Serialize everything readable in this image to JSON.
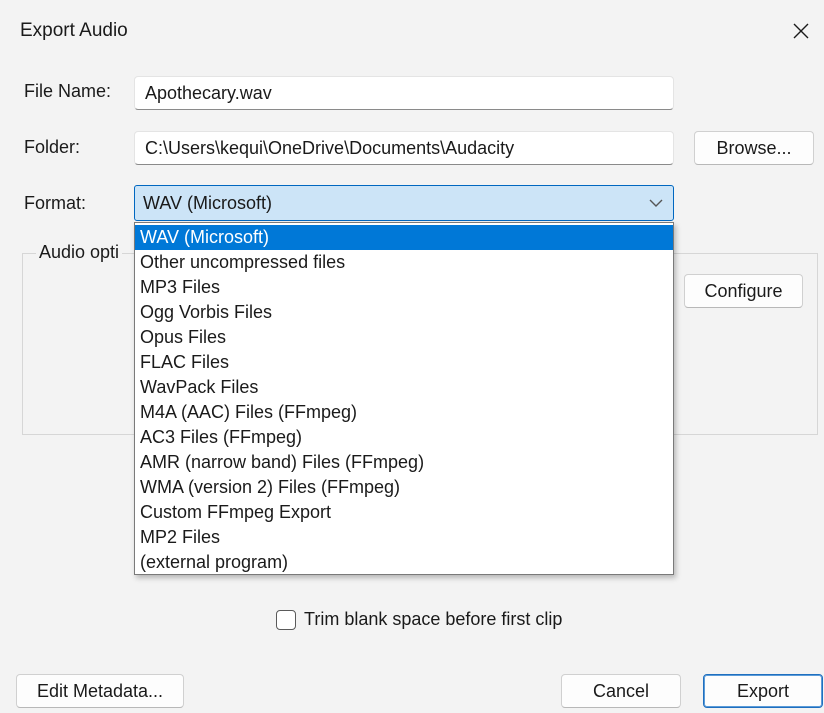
{
  "window": {
    "title": "Export Audio",
    "close_icon": "close-icon"
  },
  "file_name": {
    "label": "File Name:",
    "value": "Apothecary.wav"
  },
  "folder": {
    "label": "Folder:",
    "value": "C:\\Users\\kequi\\OneDrive\\Documents\\Audacity",
    "browse_label": "Browse..."
  },
  "format": {
    "label": "Format:",
    "selected": "WAV (Microsoft)",
    "chevron_icon": "chevron-down-icon",
    "options": [
      "WAV (Microsoft)",
      "Other uncompressed files",
      "MP3 Files",
      "Ogg Vorbis Files",
      "Opus Files",
      "FLAC Files",
      "WavPack Files",
      "M4A (AAC) Files (FFmpeg)",
      "AC3 Files (FFmpeg)",
      "AMR (narrow band) Files (FFmpeg)",
      "WMA (version 2) Files (FFmpeg)",
      "Custom FFmpeg Export",
      "MP2 Files",
      "(external program)"
    ],
    "highlighted_index": 0
  },
  "audio_options": {
    "legend": "Audio opti",
    "configure_label": "Configure"
  },
  "trim": {
    "label": "Trim blank space before first clip",
    "checked": false
  },
  "footer": {
    "edit_metadata_label": "Edit Metadata...",
    "cancel_label": "Cancel",
    "export_label": "Export"
  },
  "colors": {
    "selection": "#0078d7",
    "combo_fill": "#cce4f7",
    "dialog_bg": "#f3f3f3"
  }
}
